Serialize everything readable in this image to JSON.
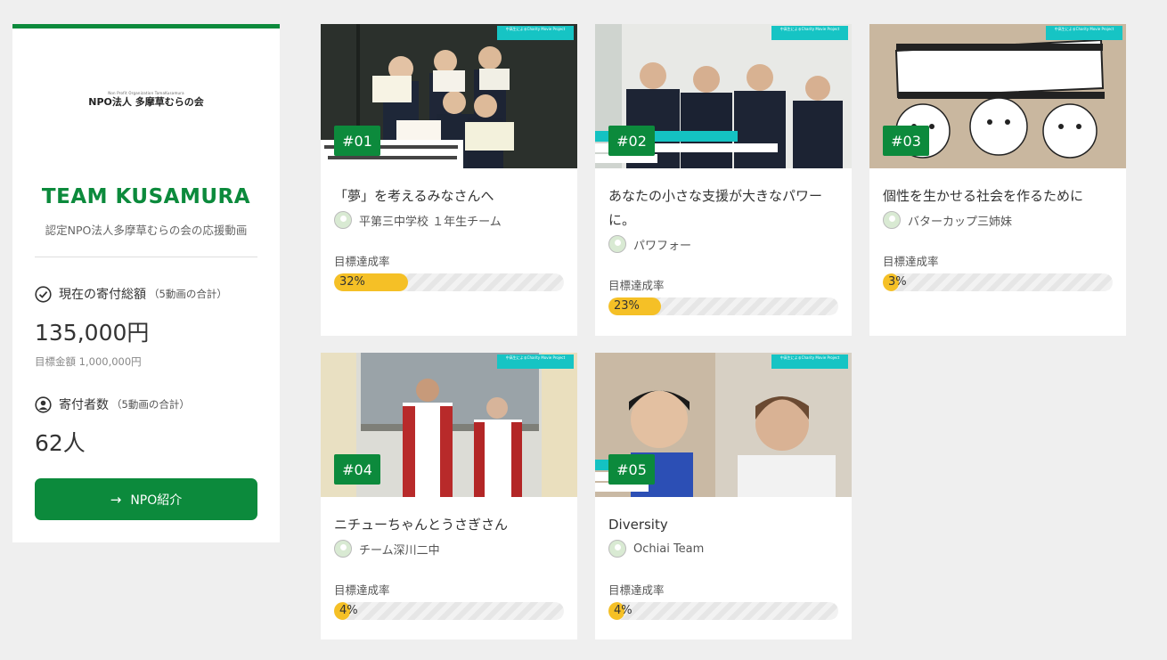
{
  "sidebar": {
    "logo_small": "Non Profit Organization TamaKusamura",
    "logo_main": "NPO法人 多摩草むらの会",
    "team_title": "TEAM KUSAMURA",
    "team_subtitle": "認定NPO法人多摩草むらの会の応援動画",
    "total_label": "現在の寄付総額",
    "total_note": "（5動画の合計）",
    "total_value": "135,000円",
    "goal_text": "目標金額 1,000,000円",
    "donors_label": "寄付者数",
    "donors_note": "（5動画の合計）",
    "donors_value": "62人",
    "npo_button": "NPO紹介",
    "arrow_icon": "→"
  },
  "progress_label": "目標達成率",
  "videos": [
    {
      "badge": "#01",
      "title": "「夢」を考えるみなさんへ",
      "author": "平第三中学校 １年生チーム",
      "percent_text": "32%",
      "percent": 32,
      "tag": "中高生によるCharity Movie Project"
    },
    {
      "badge": "#02",
      "title": "あなたの小さな支援が大きなパワーに。",
      "author": "パワフォー",
      "percent_text": "23%",
      "percent": 23,
      "tag": "中高生によるCharity Movie Project"
    },
    {
      "badge": "#03",
      "title": "個性を生かせる社会を作るために",
      "author": "バターカップ三姉妹",
      "percent_text": "3%",
      "percent": 3,
      "tag": "中高生によるCharity Movie Project"
    },
    {
      "badge": "#04",
      "title": "ニチューちゃんとうさぎさん",
      "author": "チーム深川二中",
      "percent_text": "4%",
      "percent": 4,
      "tag": "中高生によるCharity Movie Project"
    },
    {
      "badge": "#05",
      "title": "Diversity",
      "author": "Ochiai Team",
      "percent_text": "4%",
      "percent": 4,
      "tag": "中高生によるCharity Movie Project"
    }
  ],
  "colors": {
    "brand_green": "#0c8a3c",
    "progress_yellow": "#f5c026"
  }
}
